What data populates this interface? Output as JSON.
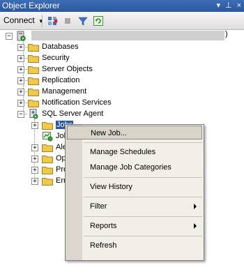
{
  "window": {
    "title": "Object Explorer",
    "controls": [
      "▾",
      "⊥",
      "×"
    ]
  },
  "toolbar": {
    "connect_label": "Connect",
    "icons": [
      "connect-object-icon",
      "disconnect-icon",
      "stop-icon",
      "filter-icon",
      "refresh-icon"
    ]
  },
  "tree": {
    "server_suffix": ")",
    "nodes": [
      {
        "label": "Databases"
      },
      {
        "label": "Security"
      },
      {
        "label": "Server Objects"
      },
      {
        "label": "Replication"
      },
      {
        "label": "Management"
      },
      {
        "label": "Notification Services"
      },
      {
        "label": "SQL Server Agent"
      }
    ],
    "agent_children": [
      {
        "label": "Jobs"
      },
      {
        "label": "Job"
      },
      {
        "label": "Ale"
      },
      {
        "label": "Op"
      },
      {
        "label": "Pro"
      },
      {
        "label": "Err"
      }
    ]
  },
  "context_menu": {
    "items": [
      {
        "label": "New Job...",
        "highlighted": true
      },
      {
        "label": "Manage Schedules"
      },
      {
        "label": "Manage Job Categories"
      },
      {
        "label": "View History"
      },
      {
        "label": "Filter",
        "submenu": true
      },
      {
        "label": "Reports",
        "submenu": true
      },
      {
        "label": "Refresh"
      }
    ]
  },
  "colors": {
    "titlebar": "#2a57a0",
    "folder": "#f0c94a",
    "menu_bg": "#f1efe8",
    "menu_highlight": "#d9d4ca"
  }
}
